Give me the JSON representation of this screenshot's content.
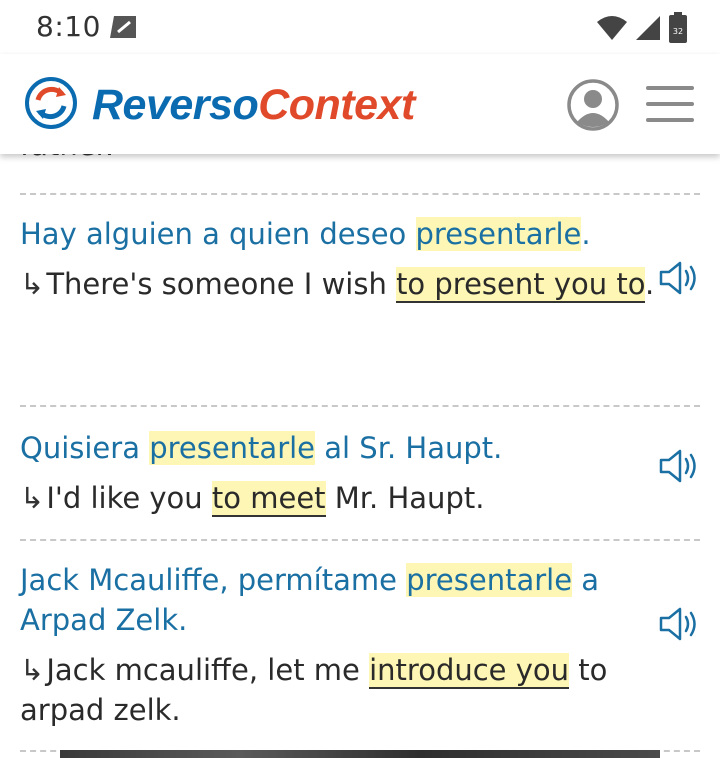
{
  "status": {
    "time": "8:10",
    "battery_label": "32"
  },
  "header": {
    "logo_reverso": "Reverso",
    "logo_context": "Context"
  },
  "prev_partial_text": "father.",
  "examples": [
    {
      "source_before": "Hay alguien a quien deseo ",
      "source_highlight": "presentarle",
      "source_after": ".",
      "target_before": "There's someone I wish ",
      "target_highlight": "to present you to",
      "target_after": "."
    },
    {
      "source_before": "Quisiera ",
      "source_highlight": "presentarle",
      "source_after": " al Sr. Haupt.",
      "target_before": "I'd like you ",
      "target_highlight": "to meet",
      "target_after": " Mr. Haupt."
    },
    {
      "source_before": "Jack Mcauliffe, permítame ",
      "source_highlight": "presentarle",
      "source_after": " a Arpad Zelk.",
      "target_before": "Jack mcauliffe, let me ",
      "target_highlight": "introduce you",
      "target_after": " to arpad zelk."
    }
  ],
  "icons": {
    "arrow": "↳",
    "speaker": "speaker-icon",
    "account": "account-icon",
    "menu": "hamburger-menu-icon"
  },
  "colors": {
    "brand_blue": "#0b6bb0",
    "brand_red": "#e04a2a",
    "source_text": "#1a6fa3",
    "highlight": "#fdf6b4"
  }
}
